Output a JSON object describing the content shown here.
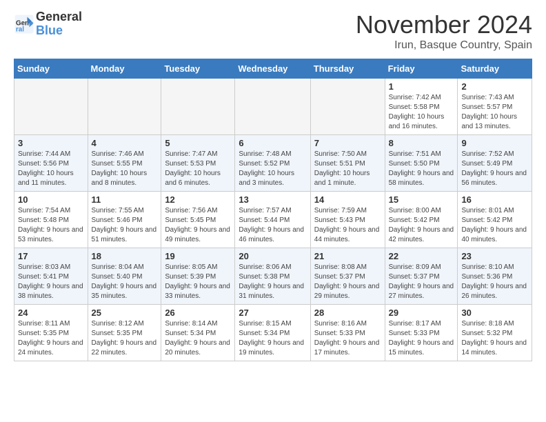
{
  "header": {
    "logo_line1": "General",
    "logo_line2": "Blue",
    "month": "November 2024",
    "location": "Irun, Basque Country, Spain"
  },
  "weekdays": [
    "Sunday",
    "Monday",
    "Tuesday",
    "Wednesday",
    "Thursday",
    "Friday",
    "Saturday"
  ],
  "weeks": [
    {
      "stripe": false,
      "days": [
        {
          "num": "",
          "info": ""
        },
        {
          "num": "",
          "info": ""
        },
        {
          "num": "",
          "info": ""
        },
        {
          "num": "",
          "info": ""
        },
        {
          "num": "",
          "info": ""
        },
        {
          "num": "1",
          "info": "Sunrise: 7:42 AM\nSunset: 5:58 PM\nDaylight: 10 hours and 16 minutes."
        },
        {
          "num": "2",
          "info": "Sunrise: 7:43 AM\nSunset: 5:57 PM\nDaylight: 10 hours and 13 minutes."
        }
      ]
    },
    {
      "stripe": true,
      "days": [
        {
          "num": "3",
          "info": "Sunrise: 7:44 AM\nSunset: 5:56 PM\nDaylight: 10 hours and 11 minutes."
        },
        {
          "num": "4",
          "info": "Sunrise: 7:46 AM\nSunset: 5:55 PM\nDaylight: 10 hours and 8 minutes."
        },
        {
          "num": "5",
          "info": "Sunrise: 7:47 AM\nSunset: 5:53 PM\nDaylight: 10 hours and 6 minutes."
        },
        {
          "num": "6",
          "info": "Sunrise: 7:48 AM\nSunset: 5:52 PM\nDaylight: 10 hours and 3 minutes."
        },
        {
          "num": "7",
          "info": "Sunrise: 7:50 AM\nSunset: 5:51 PM\nDaylight: 10 hours and 1 minute."
        },
        {
          "num": "8",
          "info": "Sunrise: 7:51 AM\nSunset: 5:50 PM\nDaylight: 9 hours and 58 minutes."
        },
        {
          "num": "9",
          "info": "Sunrise: 7:52 AM\nSunset: 5:49 PM\nDaylight: 9 hours and 56 minutes."
        }
      ]
    },
    {
      "stripe": false,
      "days": [
        {
          "num": "10",
          "info": "Sunrise: 7:54 AM\nSunset: 5:48 PM\nDaylight: 9 hours and 53 minutes."
        },
        {
          "num": "11",
          "info": "Sunrise: 7:55 AM\nSunset: 5:46 PM\nDaylight: 9 hours and 51 minutes."
        },
        {
          "num": "12",
          "info": "Sunrise: 7:56 AM\nSunset: 5:45 PM\nDaylight: 9 hours and 49 minutes."
        },
        {
          "num": "13",
          "info": "Sunrise: 7:57 AM\nSunset: 5:44 PM\nDaylight: 9 hours and 46 minutes."
        },
        {
          "num": "14",
          "info": "Sunrise: 7:59 AM\nSunset: 5:43 PM\nDaylight: 9 hours and 44 minutes."
        },
        {
          "num": "15",
          "info": "Sunrise: 8:00 AM\nSunset: 5:42 PM\nDaylight: 9 hours and 42 minutes."
        },
        {
          "num": "16",
          "info": "Sunrise: 8:01 AM\nSunset: 5:42 PM\nDaylight: 9 hours and 40 minutes."
        }
      ]
    },
    {
      "stripe": true,
      "days": [
        {
          "num": "17",
          "info": "Sunrise: 8:03 AM\nSunset: 5:41 PM\nDaylight: 9 hours and 38 minutes."
        },
        {
          "num": "18",
          "info": "Sunrise: 8:04 AM\nSunset: 5:40 PM\nDaylight: 9 hours and 35 minutes."
        },
        {
          "num": "19",
          "info": "Sunrise: 8:05 AM\nSunset: 5:39 PM\nDaylight: 9 hours and 33 minutes."
        },
        {
          "num": "20",
          "info": "Sunrise: 8:06 AM\nSunset: 5:38 PM\nDaylight: 9 hours and 31 minutes."
        },
        {
          "num": "21",
          "info": "Sunrise: 8:08 AM\nSunset: 5:37 PM\nDaylight: 9 hours and 29 minutes."
        },
        {
          "num": "22",
          "info": "Sunrise: 8:09 AM\nSunset: 5:37 PM\nDaylight: 9 hours and 27 minutes."
        },
        {
          "num": "23",
          "info": "Sunrise: 8:10 AM\nSunset: 5:36 PM\nDaylight: 9 hours and 26 minutes."
        }
      ]
    },
    {
      "stripe": false,
      "days": [
        {
          "num": "24",
          "info": "Sunrise: 8:11 AM\nSunset: 5:35 PM\nDaylight: 9 hours and 24 minutes."
        },
        {
          "num": "25",
          "info": "Sunrise: 8:12 AM\nSunset: 5:35 PM\nDaylight: 9 hours and 22 minutes."
        },
        {
          "num": "26",
          "info": "Sunrise: 8:14 AM\nSunset: 5:34 PM\nDaylight: 9 hours and 20 minutes."
        },
        {
          "num": "27",
          "info": "Sunrise: 8:15 AM\nSunset: 5:34 PM\nDaylight: 9 hours and 19 minutes."
        },
        {
          "num": "28",
          "info": "Sunrise: 8:16 AM\nSunset: 5:33 PM\nDaylight: 9 hours and 17 minutes."
        },
        {
          "num": "29",
          "info": "Sunrise: 8:17 AM\nSunset: 5:33 PM\nDaylight: 9 hours and 15 minutes."
        },
        {
          "num": "30",
          "info": "Sunrise: 8:18 AM\nSunset: 5:32 PM\nDaylight: 9 hours and 14 minutes."
        }
      ]
    }
  ]
}
